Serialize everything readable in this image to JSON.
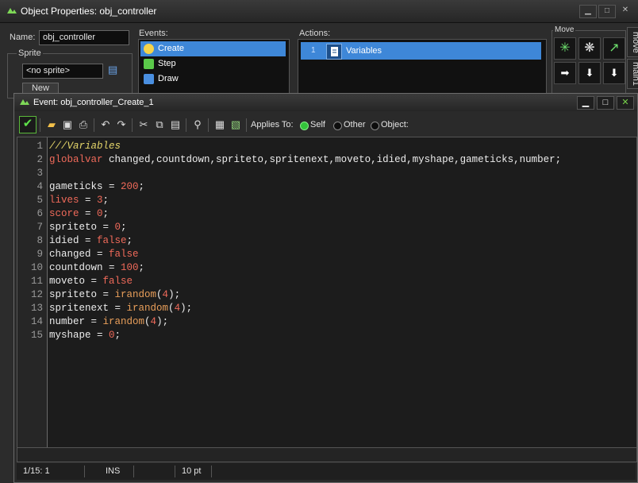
{
  "outer_window": {
    "title": "Object Properties: obj_controller",
    "name_label": "Name:",
    "name_value": "obj_controller",
    "sprite_label": "Sprite",
    "sprite_value": "<no sprite>",
    "new_button": "New",
    "events_label": "Events:",
    "events": [
      {
        "label": "Create",
        "icon": "lightbulb-icon",
        "color": "#f4d24a",
        "selected": true
      },
      {
        "label": "Step",
        "icon": "steps-icon",
        "color": "#5bc94a",
        "selected": false
      },
      {
        "label": "Draw",
        "icon": "paint-icon",
        "color": "#4a8fe0",
        "selected": false
      }
    ],
    "actions_label": "Actions:",
    "actions": [
      {
        "number": "1",
        "label": "Variables",
        "icon": "script-icon"
      }
    ],
    "move_group_label": "Move",
    "side_tabs": [
      "move",
      "main1"
    ]
  },
  "event_window": {
    "title": "Event: obj_controller_Create_1",
    "applies_to_label": "Applies To:",
    "applies_options": [
      {
        "label": "Self",
        "selected": true
      },
      {
        "label": "Other",
        "selected": false
      },
      {
        "label": "Object:",
        "selected": false
      }
    ],
    "code_lines": [
      {
        "n": "1",
        "parts": [
          {
            "t": "///Variables",
            "c": "cmt"
          }
        ]
      },
      {
        "n": "2",
        "parts": [
          {
            "t": "globalvar",
            "c": "kw"
          },
          {
            "t": " changed,countdown,spriteto,spritenext,moveto,idied,myshape,gameticks,number;",
            "c": ""
          }
        ]
      },
      {
        "n": "3",
        "parts": []
      },
      {
        "n": "4",
        "parts": [
          {
            "t": "gameticks = ",
            "c": ""
          },
          {
            "t": "200",
            "c": "num"
          },
          {
            "t": ";",
            "c": ""
          }
        ]
      },
      {
        "n": "5",
        "parts": [
          {
            "t": "lives",
            "c": "kw"
          },
          {
            "t": " = ",
            "c": ""
          },
          {
            "t": "3",
            "c": "num"
          },
          {
            "t": ";",
            "c": ""
          }
        ]
      },
      {
        "n": "6",
        "parts": [
          {
            "t": "score",
            "c": "kw"
          },
          {
            "t": " = ",
            "c": ""
          },
          {
            "t": "0",
            "c": "num"
          },
          {
            "t": ";",
            "c": ""
          }
        ]
      },
      {
        "n": "7",
        "parts": [
          {
            "t": "spriteto = ",
            "c": ""
          },
          {
            "t": "0",
            "c": "num"
          },
          {
            "t": ";",
            "c": ""
          }
        ]
      },
      {
        "n": "8",
        "parts": [
          {
            "t": "idied = ",
            "c": ""
          },
          {
            "t": "false",
            "c": "kw"
          },
          {
            "t": ";",
            "c": ""
          }
        ]
      },
      {
        "n": "9",
        "parts": [
          {
            "t": "changed = ",
            "c": ""
          },
          {
            "t": "false",
            "c": "kw"
          }
        ]
      },
      {
        "n": "10",
        "parts": [
          {
            "t": "countdown = ",
            "c": ""
          },
          {
            "t": "100",
            "c": "num"
          },
          {
            "t": ";",
            "c": ""
          }
        ]
      },
      {
        "n": "11",
        "parts": [
          {
            "t": "moveto = ",
            "c": ""
          },
          {
            "t": "false",
            "c": "kw"
          }
        ]
      },
      {
        "n": "12",
        "parts": [
          {
            "t": "spriteto = ",
            "c": ""
          },
          {
            "t": "irandom",
            "c": "fn"
          },
          {
            "t": "(",
            "c": ""
          },
          {
            "t": "4",
            "c": "num"
          },
          {
            "t": ");",
            "c": ""
          }
        ]
      },
      {
        "n": "13",
        "parts": [
          {
            "t": "spritenext = ",
            "c": ""
          },
          {
            "t": "irandom",
            "c": "fn"
          },
          {
            "t": "(",
            "c": ""
          },
          {
            "t": "4",
            "c": "num"
          },
          {
            "t": ");",
            "c": ""
          }
        ]
      },
      {
        "n": "14",
        "parts": [
          {
            "t": "number = ",
            "c": ""
          },
          {
            "t": "irandom",
            "c": "fn"
          },
          {
            "t": "(",
            "c": ""
          },
          {
            "t": "4",
            "c": "num"
          },
          {
            "t": ");",
            "c": ""
          }
        ]
      },
      {
        "n": "15",
        "parts": [
          {
            "t": "myshape = ",
            "c": ""
          },
          {
            "t": "0",
            "c": "num"
          },
          {
            "t": ";",
            "c": ""
          }
        ]
      }
    ],
    "status": {
      "position": "1/15:  1",
      "mode": "INS",
      "font_size": "10 pt"
    }
  },
  "colors": {
    "selection": "#3e87d8",
    "keyword": "#f06a5a",
    "comment": "#e5d66a",
    "function": "#e89e5a",
    "accent_green": "#33c43a"
  }
}
